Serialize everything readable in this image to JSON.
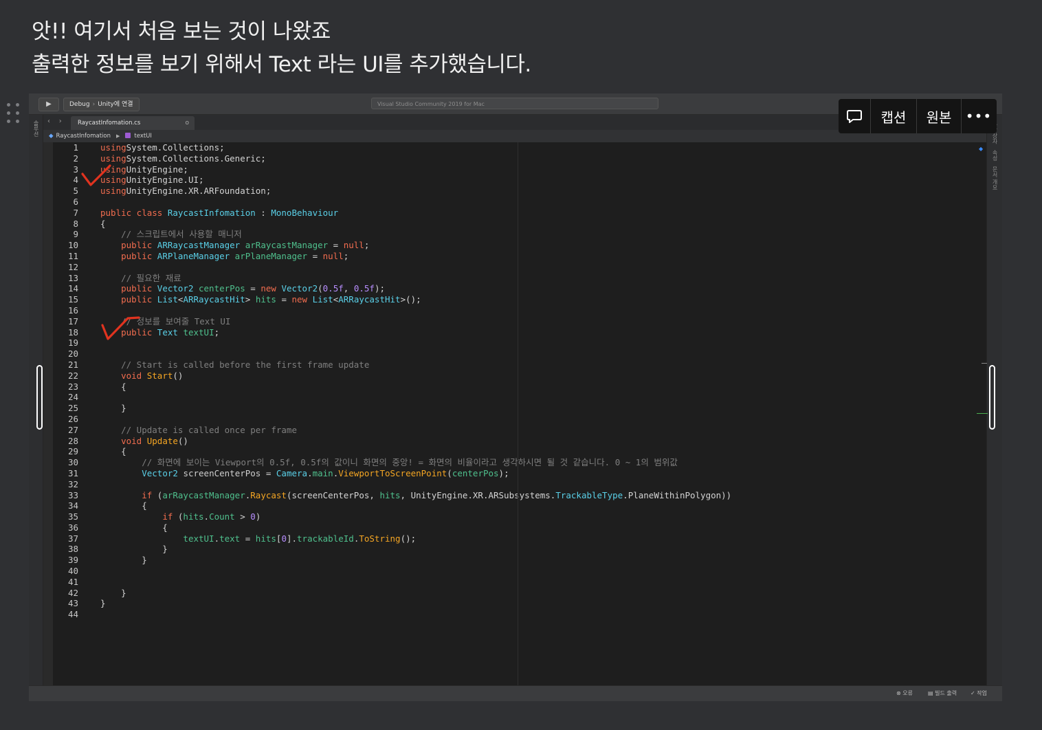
{
  "heading": {
    "line1": "앗!! 여기서 처음 보는 것이 나왔죠",
    "line2": "출력한 정보를 보기 위해서 Text 라는 UI를 추가했습니다."
  },
  "ide": {
    "toolbar": {
      "play_icon": "play-icon",
      "config": "Debug",
      "separator": "›",
      "target": "Unity에 연결",
      "window_title": "Visual Studio Community 2019 for Mac"
    },
    "tab": {
      "filename": "RaycastInfomation.cs",
      "close": "o",
      "nav_back": "‹",
      "nav_forward": "›"
    },
    "breadcrumb": {
      "class_name": "RaycastInfomation",
      "member": "textUI"
    },
    "left_rail": [
      "솔루션"
    ],
    "right_rail": [
      "도구 상자",
      "속성",
      "문서 개요"
    ],
    "status": {
      "errors": "⊗ 오류",
      "build_output": "▤ 빌드 출력",
      "tasks": "✓ 작업"
    }
  },
  "code_lines": [
    [
      [
        "kw",
        "using"
      ],
      [
        "",
        "System.Collections;"
      ]
    ],
    [
      [
        "kw",
        "using"
      ],
      [
        "",
        "System.Collections.Generic;"
      ]
    ],
    [
      [
        "kw",
        "using"
      ],
      [
        "",
        "UnityEngine;"
      ]
    ],
    [
      [
        "kw",
        "using"
      ],
      [
        "",
        "UnityEngine.UI;"
      ]
    ],
    [
      [
        "kw",
        "using"
      ],
      [
        "",
        "UnityEngine.XR.ARFoundation;"
      ]
    ],
    [],
    [
      [
        "kw",
        "public class "
      ],
      [
        "ty",
        "RaycastInfomation"
      ],
      [
        "",
        " : "
      ],
      [
        "ty",
        "MonoBehaviour"
      ]
    ],
    [
      [
        "",
        "{"
      ]
    ],
    [
      [
        "",
        "    "
      ],
      [
        "cm",
        "// 스크립트에서 사용할 매니저"
      ]
    ],
    [
      [
        "",
        "    "
      ],
      [
        "kw",
        "public "
      ],
      [
        "ty",
        "ARRaycastManager"
      ],
      [
        "ar",
        " arRaycastManager"
      ],
      [
        "",
        " = "
      ],
      [
        "kw",
        "null"
      ],
      [
        "",
        ";"
      ]
    ],
    [
      [
        "",
        "    "
      ],
      [
        "kw",
        "public "
      ],
      [
        "ty",
        "ARPlaneManager"
      ],
      [
        "ar",
        " arPlaneManager"
      ],
      [
        "",
        " = "
      ],
      [
        "kw",
        "null"
      ],
      [
        "",
        ";"
      ]
    ],
    [],
    [
      [
        "",
        "    "
      ],
      [
        "cm",
        "// 필요한 재료"
      ]
    ],
    [
      [
        "",
        "    "
      ],
      [
        "kw",
        "public "
      ],
      [
        "ty",
        "Vector2"
      ],
      [
        "ar",
        " centerPos"
      ],
      [
        "",
        " = "
      ],
      [
        "kw",
        "new "
      ],
      [
        "ty",
        "Vector2"
      ],
      [
        "",
        "("
      ],
      [
        "nu",
        "0.5f"
      ],
      [
        "",
        ", "
      ],
      [
        "nu",
        "0.5f"
      ],
      [
        "",
        ");"
      ]
    ],
    [
      [
        "",
        "    "
      ],
      [
        "kw",
        "public "
      ],
      [
        "ty",
        "List"
      ],
      [
        "",
        "<"
      ],
      [
        "ty",
        "ARRaycastHit"
      ],
      [
        "",
        "> "
      ],
      [
        "ar",
        "hits"
      ],
      [
        "",
        " = "
      ],
      [
        "kw",
        "new "
      ],
      [
        "ty",
        "List"
      ],
      [
        "",
        "<"
      ],
      [
        "ty",
        "ARRaycastHit"
      ],
      [
        "",
        ">();"
      ]
    ],
    [],
    [
      [
        "",
        "    "
      ],
      [
        "cm",
        "// 정보를 보여줄 Text UI"
      ]
    ],
    [
      [
        "",
        "    "
      ],
      [
        "kw",
        "public "
      ],
      [
        "ty",
        "Text "
      ],
      [
        "ar",
        "textUI"
      ],
      [
        "",
        ";"
      ]
    ],
    [],
    [],
    [
      [
        "",
        "    "
      ],
      [
        "cm",
        "// Start is called before the first frame update"
      ]
    ],
    [
      [
        "",
        "    "
      ],
      [
        "kw",
        "void "
      ],
      [
        "me",
        "Start"
      ],
      [
        "",
        "()"
      ]
    ],
    [
      [
        "",
        "    {"
      ]
    ],
    [],
    [
      [
        "",
        "    }"
      ]
    ],
    [],
    [
      [
        "",
        "    "
      ],
      [
        "cm",
        "// Update is called once per frame"
      ]
    ],
    [
      [
        "",
        "    "
      ],
      [
        "kw",
        "void "
      ],
      [
        "me",
        "Update"
      ],
      [
        "",
        "()"
      ]
    ],
    [
      [
        "",
        "    {"
      ]
    ],
    [
      [
        "",
        "        "
      ],
      [
        "cm",
        "// 화면에 보이는 Viewport의 0.5f, 0.5f의 값이니 화면의 중앙! = 화면의 비율이라고 생각하시면 될 것 같습니다. 0 ~ 1의 범위값"
      ]
    ],
    [
      [
        "",
        "        "
      ],
      [
        "ty",
        "Vector2 "
      ],
      [
        "vr",
        "screenCenterPos"
      ],
      [
        "",
        " = "
      ],
      [
        "ty",
        "Camera"
      ],
      [
        "",
        "."
      ],
      [
        "ar",
        "main"
      ],
      [
        "",
        "."
      ],
      [
        "me",
        "ViewportToScreenPoint"
      ],
      [
        "",
        "("
      ],
      [
        "ar",
        "centerPos"
      ],
      [
        "",
        ");"
      ]
    ],
    [],
    [
      [
        "",
        "        "
      ],
      [
        "kw",
        "if "
      ],
      [
        "",
        "("
      ],
      [
        "ar",
        "arRaycastManager"
      ],
      [
        "",
        "."
      ],
      [
        "me",
        "Raycast"
      ],
      [
        "",
        "(screenCenterPos, "
      ],
      [
        "ar",
        "hits"
      ],
      [
        "",
        ", UnityEngine.XR.ARSubsystems."
      ],
      [
        "ty",
        "TrackableType"
      ],
      [
        "",
        ".PlaneWithinPolygon))"
      ]
    ],
    [
      [
        "",
        "        {"
      ]
    ],
    [
      [
        "",
        "            "
      ],
      [
        "kw",
        "if "
      ],
      [
        "",
        "("
      ],
      [
        "ar",
        "hits"
      ],
      [
        "",
        "."
      ],
      [
        "ar",
        "Count"
      ],
      [
        "",
        " > "
      ],
      [
        "nu",
        "0"
      ],
      [
        "",
        ")"
      ]
    ],
    [
      [
        "",
        "            {"
      ]
    ],
    [
      [
        "",
        "                "
      ],
      [
        "ar",
        "textUI"
      ],
      [
        "",
        "."
      ],
      [
        "ar",
        "text"
      ],
      [
        "",
        " = "
      ],
      [
        "ar",
        "hits"
      ],
      [
        "",
        "["
      ],
      [
        "nu",
        "0"
      ],
      [
        "",
        "]."
      ],
      [
        "ar",
        "trackableId"
      ],
      [
        "",
        "."
      ],
      [
        "me",
        "ToString"
      ],
      [
        "",
        "();"
      ]
    ],
    [
      [
        "",
        "            }"
      ]
    ],
    [
      [
        "",
        "        }"
      ]
    ],
    [],
    [],
    [
      [
        "",
        "    }"
      ]
    ],
    [
      [
        "",
        "}"
      ]
    ],
    []
  ],
  "overlay": {
    "comment_icon": "speech-bubble-icon",
    "caption": "캡션",
    "original": "원본",
    "more": "•••"
  },
  "colors": {
    "keyword": "#f26d4f",
    "type": "#5ad0e8",
    "comment": "#7f7f7f",
    "number": "#b88eff",
    "method": "#f5a623",
    "field": "#4fc08d",
    "check_mark": "#e0331f"
  }
}
